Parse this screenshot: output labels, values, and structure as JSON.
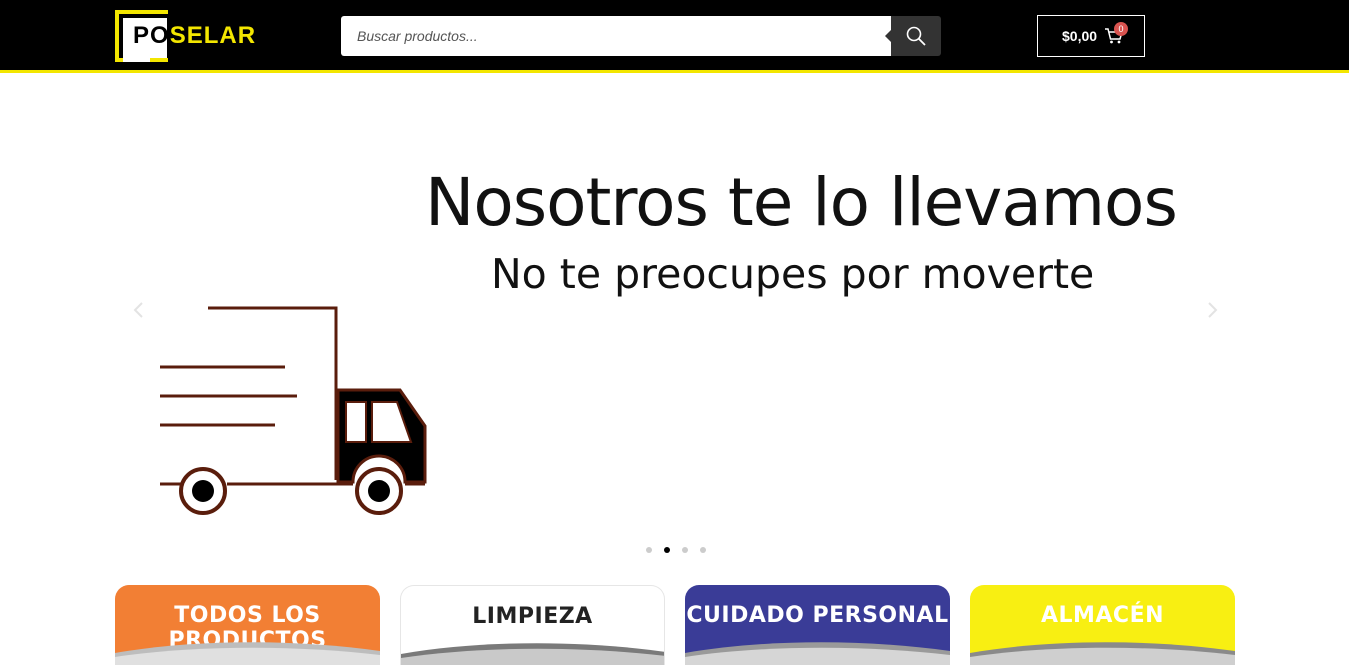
{
  "header": {
    "logo": {
      "text_part1": "P",
      "text_part2": "O",
      "text_part3": "SELAR"
    },
    "search": {
      "placeholder": "Buscar productos..."
    },
    "cart": {
      "amount": "$0,00",
      "count": "0"
    },
    "colors": {
      "brand_yellow": "#f3e600",
      "header_bg": "#000000"
    }
  },
  "slider": {
    "title": "Nosotros te lo llevamos",
    "subtitle": "No te preocupes por moverte",
    "illustration": "delivery-truck",
    "current_slide": 2,
    "slide_count": 4
  },
  "categories": [
    {
      "label": "TODOS LOS PRODUCTOS",
      "bg": "#f27f34",
      "color": "#ffffff"
    },
    {
      "label": "LIMPIEZA",
      "bg": "#ffffff",
      "color": "#222222"
    },
    {
      "label": "CUIDADO PERSONAL",
      "bg": "#3a3c97",
      "color": "#ffffff"
    },
    {
      "label": "ALMACÉN",
      "bg": "#f8ef12",
      "color": "#ffffff"
    }
  ]
}
